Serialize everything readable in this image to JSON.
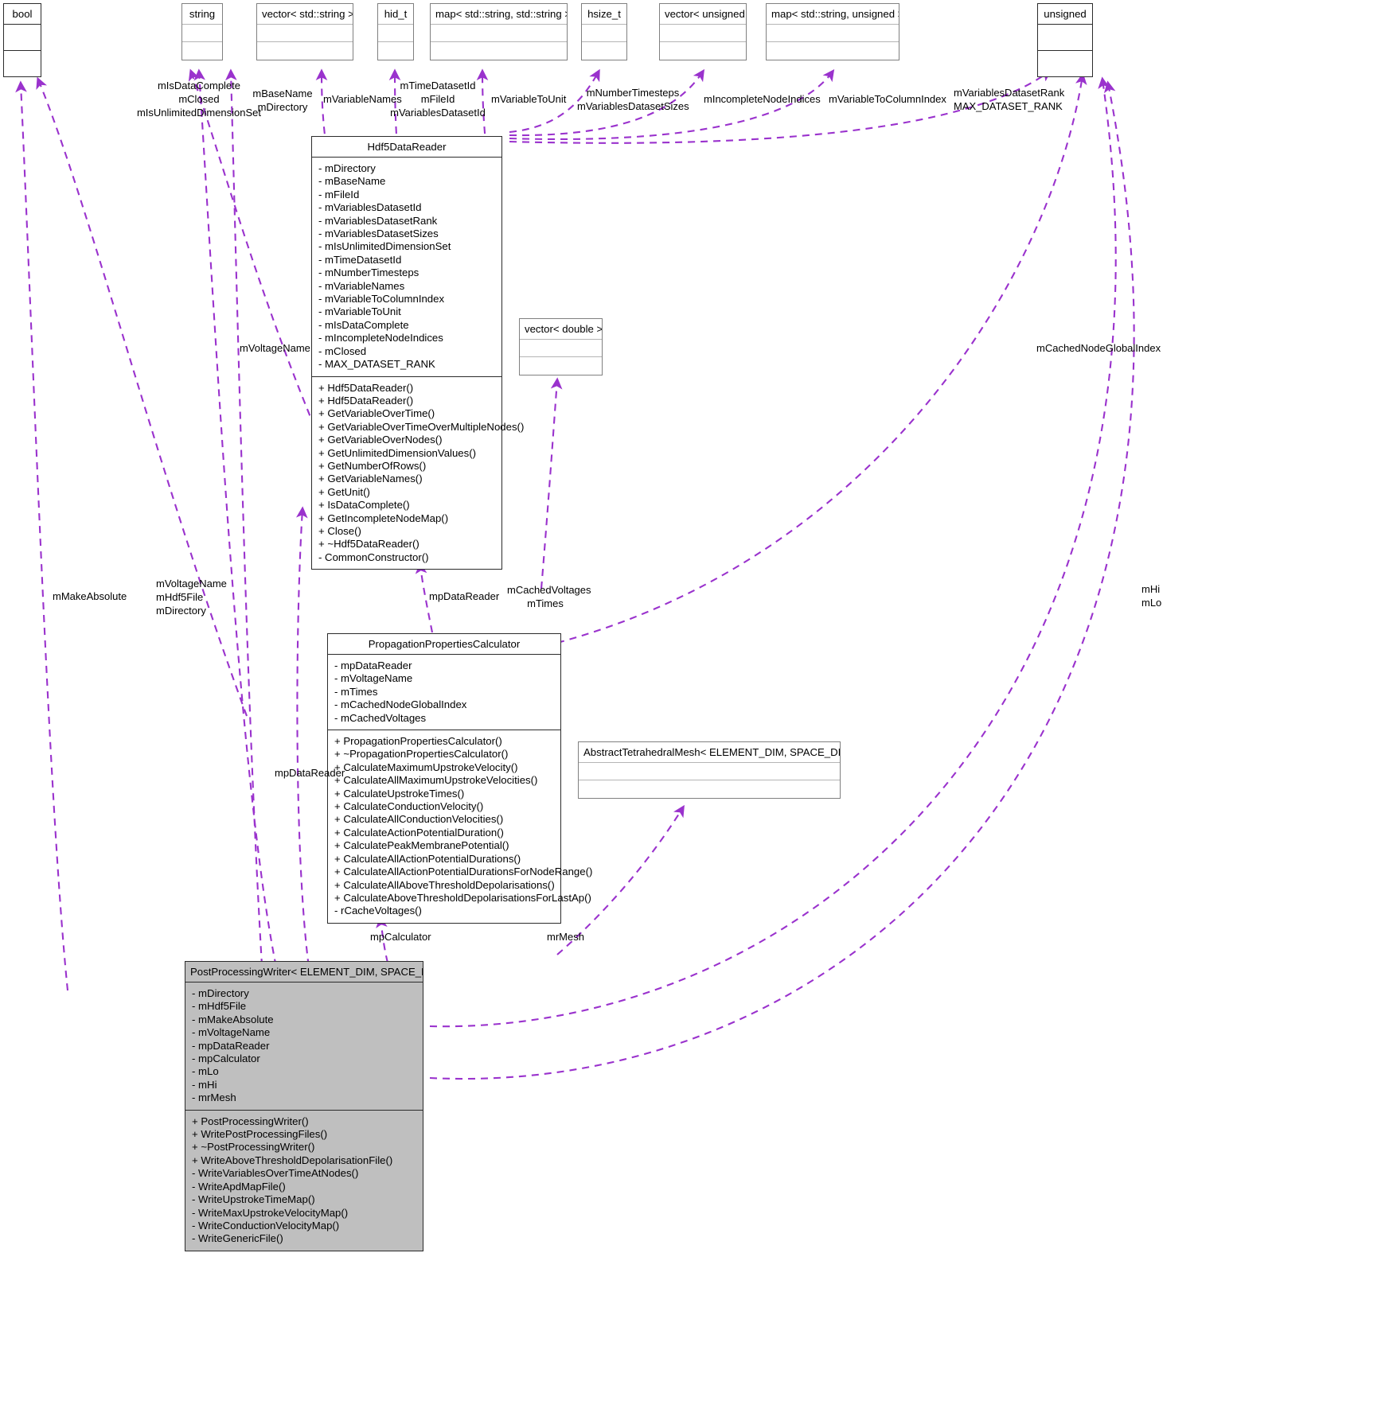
{
  "diagram": {
    "type": "uml-collaboration-diagram",
    "accent_edge_color": "#9a32cd",
    "highlight_fill": "#bfbfbf",
    "border_color": "#2b2b2b"
  },
  "nodes": {
    "bool": {
      "title": "bool",
      "members": [],
      "methods": []
    },
    "string": {
      "title": "string",
      "members": [],
      "methods": []
    },
    "vector_string": {
      "title": "vector< std::string >",
      "members": [],
      "methods": []
    },
    "hid_t": {
      "title": "hid_t",
      "members": [],
      "methods": []
    },
    "map_string_string": {
      "title": "map< std::string, std::string >",
      "members": [],
      "methods": []
    },
    "hsize_t": {
      "title": "hsize_t",
      "members": [],
      "methods": []
    },
    "vector_unsigned": {
      "title": "vector< unsigned >",
      "members": [],
      "methods": []
    },
    "map_string_unsigned": {
      "title": "map< std::string, unsigned >",
      "members": [],
      "methods": []
    },
    "unsigned": {
      "title": "unsigned",
      "members": [],
      "methods": []
    },
    "vector_double": {
      "title": "vector< double >",
      "members": [],
      "methods": []
    },
    "abstract_mesh": {
      "title": "AbstractTetrahedralMesh< ELEMENT_DIM, SPACE_DIM > &",
      "members": [],
      "methods": []
    },
    "hdf5datareader": {
      "title": "Hdf5DataReader",
      "members": [
        "- mDirectory",
        "- mBaseName",
        "- mFileId",
        "- mVariablesDatasetId",
        "- mVariablesDatasetRank",
        "- mVariablesDatasetSizes",
        "- mIsUnlimitedDimensionSet",
        "- mTimeDatasetId",
        "- mNumberTimesteps",
        "- mVariableNames",
        "- mVariableToColumnIndex",
        "- mVariableToUnit",
        "- mIsDataComplete",
        "- mIncompleteNodeIndices",
        "- mClosed",
        "- MAX_DATASET_RANK"
      ],
      "methods": [
        "+ Hdf5DataReader()",
        "+ Hdf5DataReader()",
        "+ GetVariableOverTime()",
        "+ GetVariableOverTimeOverMultipleNodes()",
        "+ GetVariableOverNodes()",
        "+ GetUnlimitedDimensionValues()",
        "+ GetNumberOfRows()",
        "+ GetVariableNames()",
        "+ GetUnit()",
        "+ IsDataComplete()",
        "+ GetIncompleteNodeMap()",
        "+ Close()",
        "+ ~Hdf5DataReader()",
        "- CommonConstructor()"
      ]
    },
    "propagation": {
      "title": "PropagationPropertiesCalculator",
      "members": [
        "- mpDataReader",
        "- mVoltageName",
        "- mTimes",
        "- mCachedNodeGlobalIndex",
        "- mCachedVoltages"
      ],
      "methods": [
        "+ PropagationPropertiesCalculator()",
        "+ ~PropagationPropertiesCalculator()",
        "+ CalculateMaximumUpstrokeVelocity()",
        "+ CalculateAllMaximumUpstrokeVelocities()",
        "+ CalculateUpstrokeTimes()",
        "+ CalculateConductionVelocity()",
        "+ CalculateAllConductionVelocities()",
        "+ CalculateActionPotentialDuration()",
        "+ CalculatePeakMembranePotential()",
        "+ CalculateAllActionPotentialDurations()",
        "+ CalculateAllActionPotentialDurationsForNodeRange()",
        "+ CalculateAllAboveThresholdDepolarisations()",
        "+ CalculateAboveThresholdDepolarisationsForLastAp()",
        "- rCacheVoltages()"
      ]
    },
    "postprocessing": {
      "title": "PostProcessingWriter< ELEMENT_DIM, SPACE_DIM >",
      "members": [
        "- mDirectory",
        "- mHdf5File",
        "- mMakeAbsolute",
        "- mVoltageName",
        "- mpDataReader",
        "- mpCalculator",
        "- mLo",
        "- mHi",
        "- mrMesh"
      ],
      "methods": [
        "+ PostProcessingWriter()",
        "+ WritePostProcessingFiles()",
        "+ ~PostProcessingWriter()",
        "+ WriteAboveThresholdDepolarisationFile()",
        "- WriteVariablesOverTimeAtNodes()",
        "- WriteApdMapFile()",
        "- WriteUpstrokeTimeMap()",
        "- WriteMaxUpstrokeVelocityMap()",
        "- WriteConductionVelocityMap()",
        "- WriteGenericFile()"
      ]
    }
  },
  "edge_labels": {
    "bool_from_hdf5": "mIsDataComplete\nmClosed\nmIsUnlimitedDimensionSet",
    "bool_l1": "mIsDataComplete",
    "bool_l2": "mClosed",
    "bool_l3": "mIsUnlimitedDimensionSet",
    "string_l1": "mBaseName",
    "string_l2": "mDirectory",
    "vector_string_l1": "mVariableNames",
    "hid_t_l1": "mTimeDatasetId",
    "hid_t_l2": "mFileId",
    "hid_t_l3": "mVariablesDatasetId",
    "map_ss_l1": "mVariableToUnit",
    "hsize_l1": "mNumberTimesteps",
    "hsize_l2": "mVariablesDatasetSizes",
    "vec_unsigned_l1": "mIncompleteNodeIndices",
    "map_su_l1": "mVariableToColumnIndex",
    "unsigned_l1": "mVariablesDatasetRank",
    "unsigned_l2": "MAX_DATASET_RANK",
    "unsigned_r1": "mCachedNodeGlobalIndex",
    "unsigned_r2": "mHi",
    "unsigned_r3": "mLo",
    "voltage_name_mid": "mVoltageName",
    "makeabsolute": "mMakeAbsolute",
    "ppw_string_l1": "mVoltageName",
    "ppw_string_l2": "mHdf5File",
    "ppw_string_l3": "mDirectory",
    "mpdatareader_top": "mpDataReader",
    "cached_voltages_l1": "mCachedVoltages",
    "cached_voltages_l2": "mTimes",
    "mpdatareader_lower": "mpDataReader",
    "mpcalculator": "mpCalculator",
    "mrmesh": "mrMesh"
  }
}
